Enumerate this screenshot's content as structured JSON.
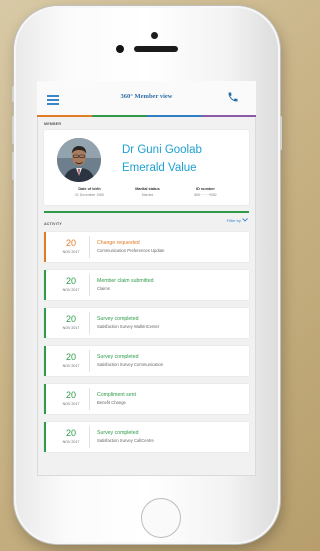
{
  "header": {
    "title": "360° Member view",
    "menu_icon": "hamburger-icon",
    "call_icon": "phone-icon",
    "colors": {
      "accent": "#2f6fa8",
      "brand_blue": "#1ea1d2",
      "green": "#2e9b48",
      "orange": "#e07b26",
      "purple": "#8b5aa8"
    }
  },
  "member": {
    "section_label": "MEMBER",
    "name": "Dr Guni Goolab",
    "tier": "Emerald Value",
    "details": [
      {
        "label": "Date of birth",
        "value": "01 December 1985"
      },
      {
        "label": "Marital status",
        "value": "Married"
      },
      {
        "label": "ID number",
        "value": "865········9082"
      }
    ]
  },
  "activity": {
    "section_label": "ACTIVITY",
    "filter_label": "Filter by",
    "items": [
      {
        "day": "20",
        "month_year": "NOV 2017",
        "title": "Change requested",
        "subtitle": "Communication Preferences Update",
        "status": "orange"
      },
      {
        "day": "20",
        "month_year": "NOV 2017",
        "title": "Member claim submitted",
        "subtitle": "Claims",
        "status": "green"
      },
      {
        "day": "20",
        "month_year": "NOV 2017",
        "title": "Survey completed",
        "subtitle": "Satisfaction Survey WalkInCenter",
        "status": "green"
      },
      {
        "day": "20",
        "month_year": "NOV 2017",
        "title": "Survey completed",
        "subtitle": "Satisfaction Survey Communication",
        "status": "green"
      },
      {
        "day": "20",
        "month_year": "NOV 2017",
        "title": "Compliment sent",
        "subtitle": "Benefit Change",
        "status": "green"
      },
      {
        "day": "20",
        "month_year": "NOV 2017",
        "title": "Survey completed",
        "subtitle": "Satisfaction Survey CallCentre",
        "status": "green"
      }
    ]
  }
}
